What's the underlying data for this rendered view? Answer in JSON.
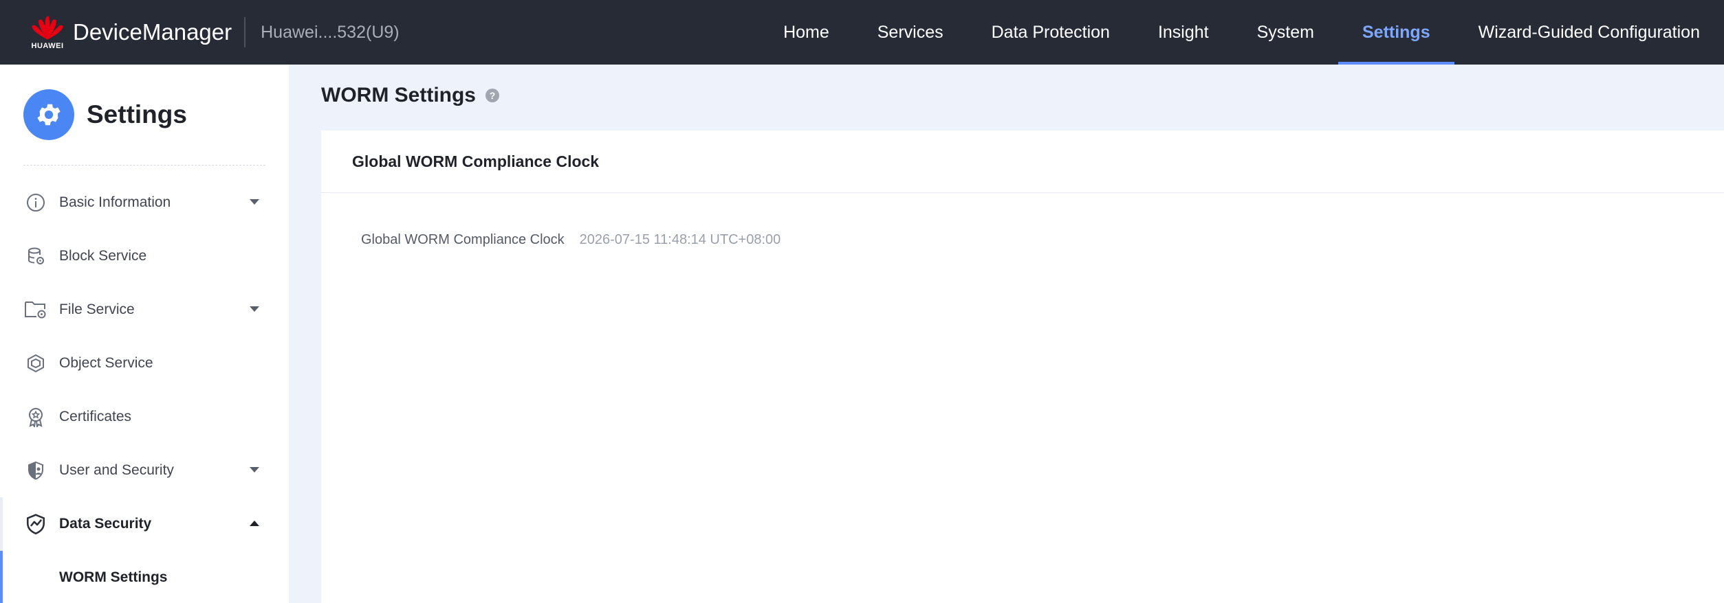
{
  "header": {
    "logo_text": "HUAWEI",
    "app_name": "DeviceManager",
    "device_name": "Huawei....532(U9)",
    "nav": [
      {
        "label": "Home",
        "active": false
      },
      {
        "label": "Services",
        "active": false
      },
      {
        "label": "Data Protection",
        "active": false
      },
      {
        "label": "Insight",
        "active": false
      },
      {
        "label": "System",
        "active": false
      },
      {
        "label": "Settings",
        "active": true
      },
      {
        "label": "Wizard-Guided Configuration",
        "active": false
      }
    ]
  },
  "sidebar": {
    "title": "Settings",
    "items": [
      {
        "label": "Basic Information",
        "icon": "info-icon",
        "caret": "down"
      },
      {
        "label": "Block Service",
        "icon": "database-gear-icon",
        "caret": null
      },
      {
        "label": "File Service",
        "icon": "folder-gear-icon",
        "caret": "down"
      },
      {
        "label": "Object Service",
        "icon": "cube-icon",
        "caret": null
      },
      {
        "label": "Certificates",
        "icon": "certificate-icon",
        "caret": null
      },
      {
        "label": "User and Security",
        "icon": "shield-user-icon",
        "caret": "down"
      },
      {
        "label": "Data Security",
        "icon": "shield-check-icon",
        "caret": "up"
      }
    ],
    "subitems": [
      {
        "label": "WORM Settings",
        "active": true
      }
    ]
  },
  "main": {
    "page_title": "WORM Settings",
    "help_glyph": "?",
    "card_title": "Global WORM Compliance Clock",
    "field_label": "Global WORM Compliance Clock",
    "field_value": "2026-07-15 11:48:14 UTC+08:00"
  },
  "colors": {
    "topbar": "#262b36",
    "accent": "#5b8dff",
    "page_bg": "#eef2fa"
  }
}
